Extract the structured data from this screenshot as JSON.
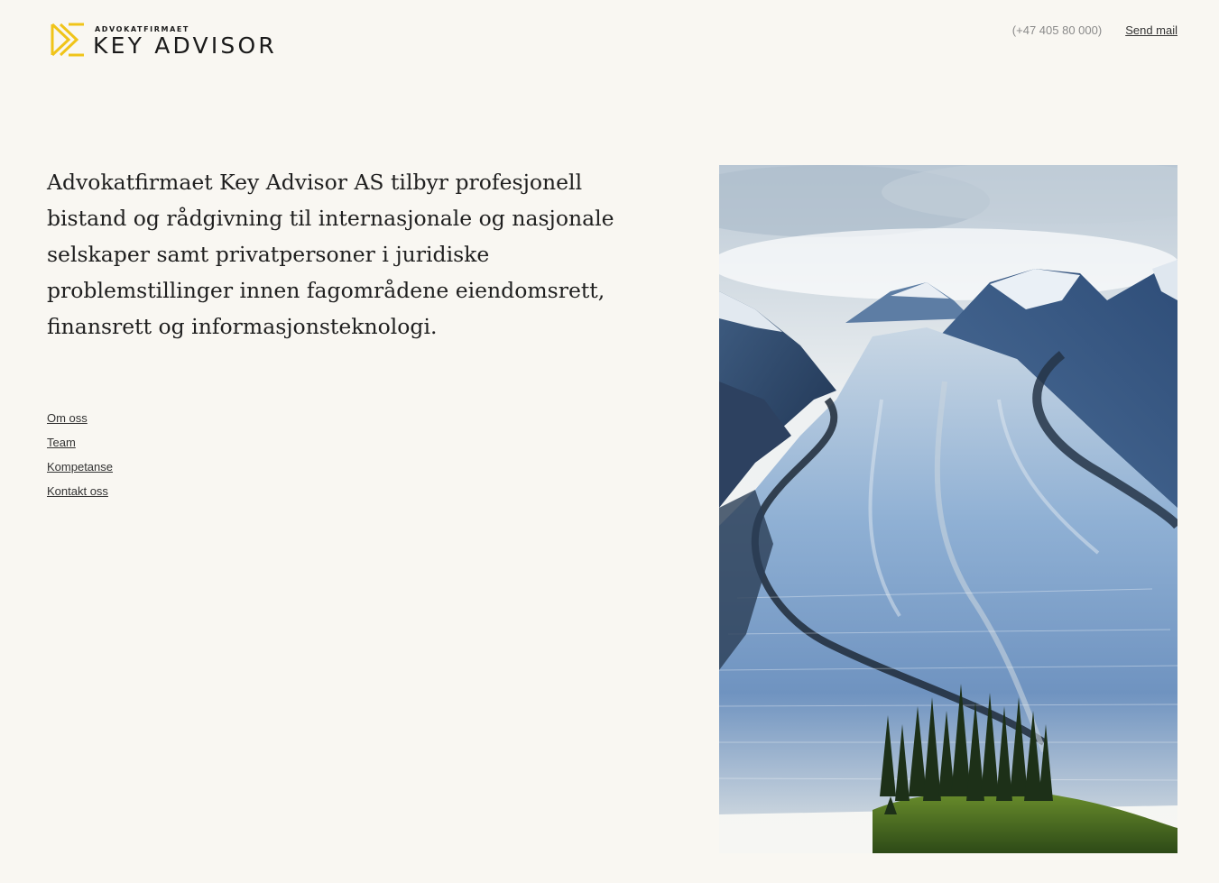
{
  "brand": {
    "kicker": "ADVOKATFIRMAET",
    "name": "KEY ADVISOR",
    "accent_color": "#f0c419"
  },
  "header": {
    "phone": "(+47 405 80 000)",
    "mail_link": "Send mail"
  },
  "intro": {
    "text": "Advokatfirmaet Key Advisor AS tilbyr profesjonell bistand og rådgivning til internasjonale og nasjonale selskaper samt privatpersoner i juridiske problemstillinger innen fagområdene eiendomsrett, finansrett og informasjonsteknologi."
  },
  "nav": {
    "items": [
      {
        "label": "Om oss"
      },
      {
        "label": "Team"
      },
      {
        "label": "Kompetanse"
      },
      {
        "label": "Kontakt oss"
      }
    ]
  },
  "hero_image": {
    "subject": "glacier-landscape"
  }
}
